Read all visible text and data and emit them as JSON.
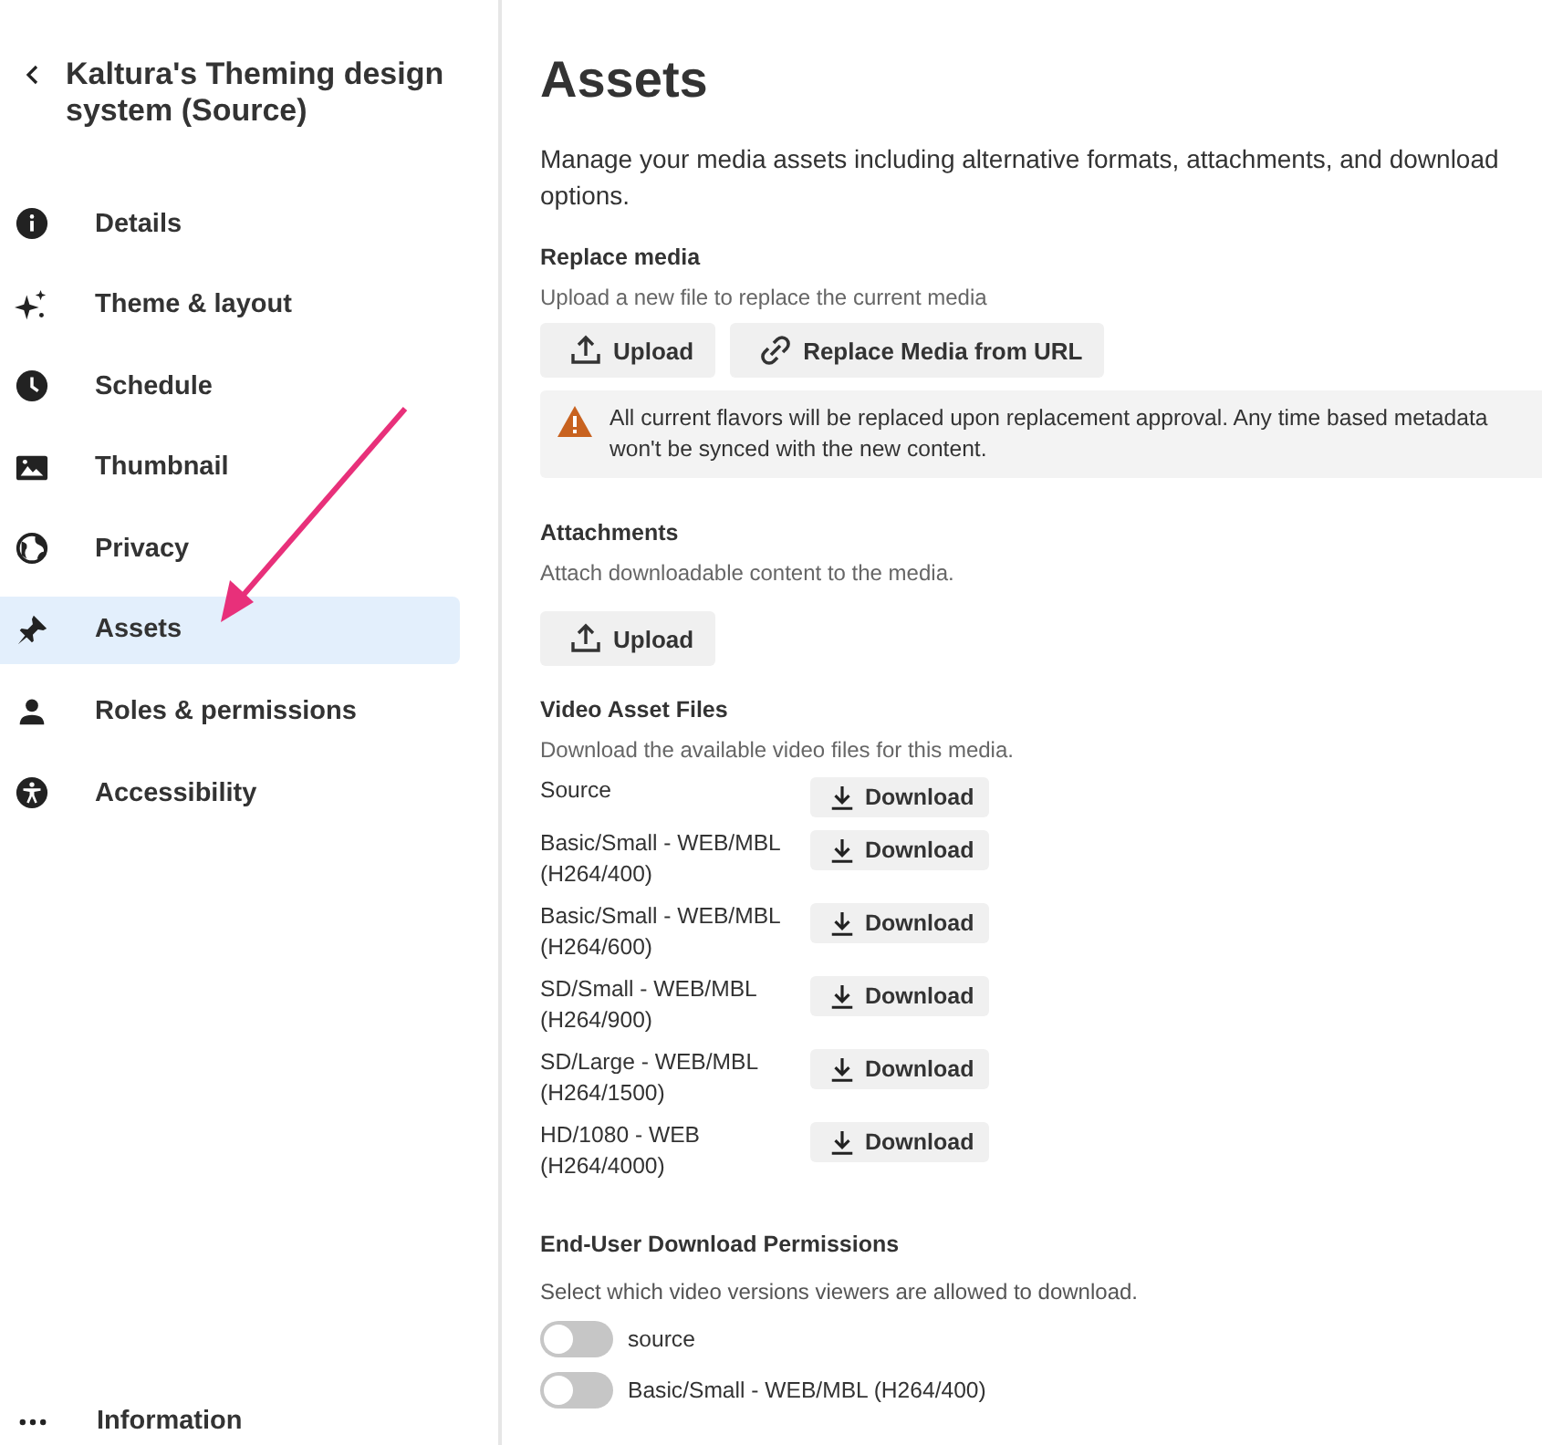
{
  "sidebar": {
    "back_title": "Kaltura's Theming design system (Source)",
    "items": [
      {
        "label": "Details",
        "selected": false
      },
      {
        "label": "Theme & layout",
        "selected": false
      },
      {
        "label": "Schedule",
        "selected": false
      },
      {
        "label": "Thumbnail",
        "selected": false
      },
      {
        "label": "Privacy",
        "selected": false
      },
      {
        "label": "Assets",
        "selected": true
      },
      {
        "label": "Roles & permissions",
        "selected": false
      },
      {
        "label": "Accessibility",
        "selected": false
      }
    ],
    "footer": {
      "label": "Information"
    }
  },
  "main": {
    "title": "Assets",
    "description": "Manage your media assets including alternative formats, attachments, and download options.",
    "replace_media": {
      "heading": "Replace media",
      "subtitle": "Upload a new file to replace the current media",
      "buttons": [
        {
          "label": "Upload"
        },
        {
          "label": "Replace Media from URL"
        }
      ],
      "warning": "All current flavors will be replaced upon replacement approval. Any time based metadata won't be synced with the new content."
    },
    "attachments": {
      "heading": "Attachments",
      "subtitle": "Attach downloadable content to the media.",
      "button": "Upload"
    },
    "video_files": {
      "heading": "Video Asset Files",
      "subtitle": "Download the available video files for this media.",
      "files": [
        {
          "name": "Source",
          "button": "Download"
        },
        {
          "name": "Basic/Small - WEB/MBL (H264/400)",
          "button": "Download"
        },
        {
          "name": "Basic/Small - WEB/MBL (H264/600)",
          "button": "Download"
        },
        {
          "name": "SD/Small - WEB/MBL (H264/900)",
          "button": "Download"
        },
        {
          "name": "SD/Large - WEB/MBL (H264/1500)",
          "button": "Download"
        },
        {
          "name": "HD/1080 - WEB (H264/4000)",
          "button": "Download"
        }
      ]
    },
    "permissions": {
      "heading": "End-User Download Permissions",
      "subtitle": "Select which video versions viewers are allowed to download.",
      "options": [
        {
          "label": "source",
          "on": false
        },
        {
          "label": "Basic/Small - WEB/MBL (H264/400)",
          "on": false
        }
      ]
    }
  }
}
